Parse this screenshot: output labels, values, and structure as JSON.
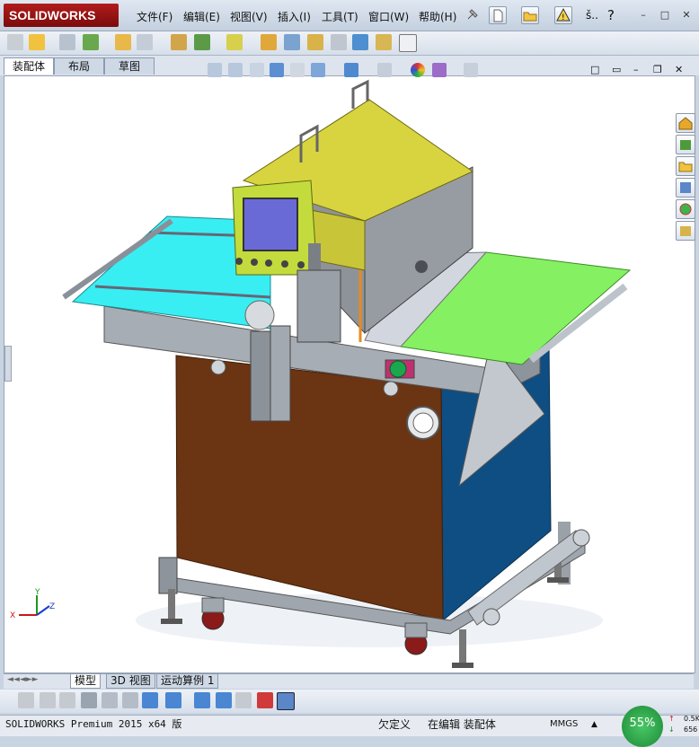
{
  "app": {
    "logo_text": "SOLIDWORKS"
  },
  "menu": [
    "文件(F)",
    "编辑(E)",
    "视图(V)",
    "插入(I)",
    "工具(T)",
    "窗口(W)",
    "帮助(H)"
  ],
  "titlebar": {
    "search_text": "š..",
    "help_glyph": "?"
  },
  "window_controls": {
    "minimize": "–",
    "restore": "□",
    "close": "✕"
  },
  "tabs": [
    "装配体",
    "布局",
    "草图"
  ],
  "active_tab": "装配体",
  "model_view_controls": {
    "restore": "□",
    "tile": "▭",
    "minimize": "–",
    "maximize": "❐",
    "close": "✕"
  },
  "bottom_tabs": [
    "模型",
    "3D 视图",
    "运动算例 1"
  ],
  "active_bottom_tab": "模型",
  "status": {
    "product": "SOLIDWORKS Premium 2015 x64 版",
    "definition": "欠定义",
    "editing": "在编辑 装配体",
    "units": "MMGS",
    "caret": "▲",
    "usage_percent": "55%",
    "net_up": "0.5K",
    "net_down": "656"
  },
  "triad": {
    "x": "X",
    "y": "Y",
    "z": "Z"
  },
  "colors": {
    "accent_red": "#b21c1c",
    "machine_yellow": "#d8d440",
    "table_cyan": "#38eef2",
    "table_green": "#86f063",
    "panel_brown": "#6b3412",
    "panel_blue": "#0f4e82"
  }
}
